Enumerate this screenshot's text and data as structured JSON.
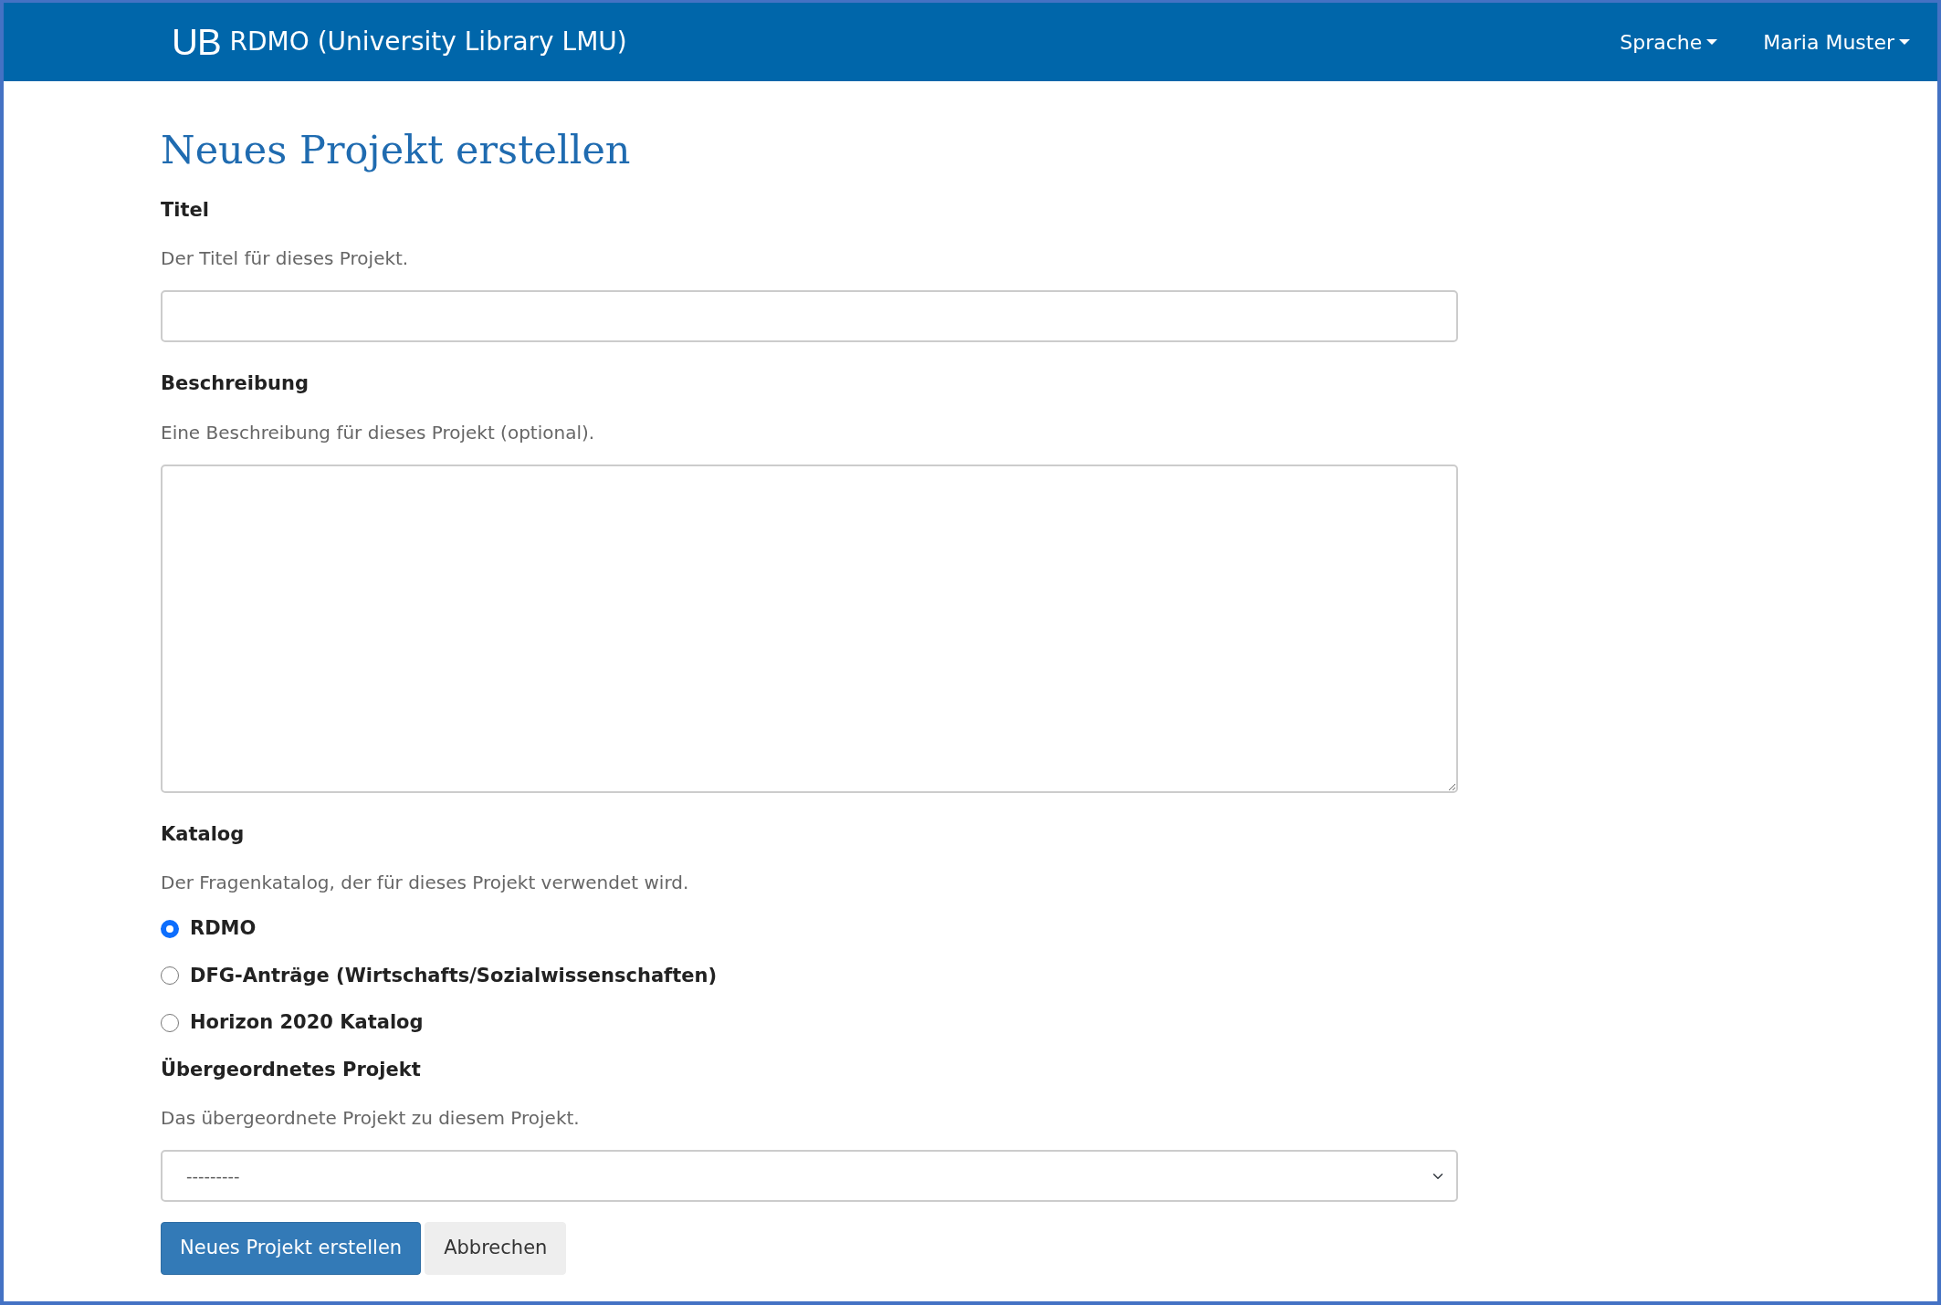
{
  "navbar": {
    "logo": "UB",
    "brand": "RDMO (University Library LMU)",
    "menus": [
      {
        "label": "Sprache"
      },
      {
        "label": "Maria Muster"
      }
    ]
  },
  "page_title": "Neues Projekt erstellen",
  "fields": [
    {
      "kind": "text",
      "label": "Titel",
      "help": "Der Titel für dieses Projekt."
    },
    {
      "kind": "textarea",
      "label": "Beschreibung",
      "help": "Eine Beschreibung für dieses Projekt (optional)."
    },
    {
      "kind": "radio",
      "label": "Katalog",
      "help": "Der Fragenkatalog, der für dieses Projekt verwendet wird.",
      "options": [
        {
          "label": "RDMO",
          "selected": true
        },
        {
          "label": "DFG-Anträge (Wirtschafts/Sozialwissenschaften)",
          "selected": false
        },
        {
          "label": "Horizon 2020 Katalog",
          "selected": false
        }
      ]
    },
    {
      "kind": "select",
      "label": "Übergeordnetes Projekt",
      "help": "Das übergeordnete Projekt zu diesem Projekt.",
      "value": "---------"
    }
  ],
  "buttons": [
    {
      "label": "Neues Projekt erstellen",
      "kind": "primary"
    },
    {
      "label": "Abbrechen",
      "kind": "secondary"
    }
  ]
}
